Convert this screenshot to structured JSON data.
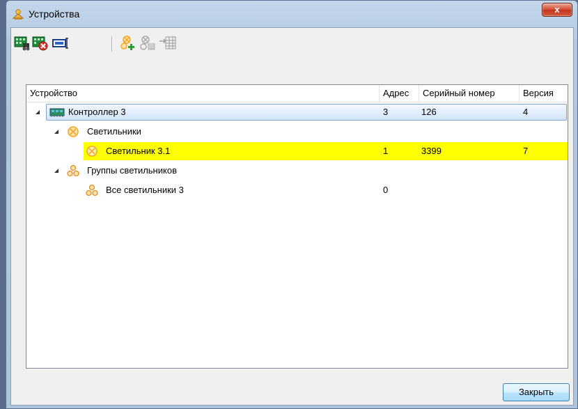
{
  "window": {
    "title": "Устройства",
    "close_symbol": "x"
  },
  "toolbar": {
    "buttons": [
      {
        "icon": "controller-search-icon"
      },
      {
        "icon": "controller-remove-icon"
      },
      {
        "icon": "controller-properties-icon"
      },
      {
        "icon": "add-fixture-icon"
      },
      {
        "icon": "add-fixture-group-icon-disabled"
      },
      {
        "icon": "import-grid-icon-disabled"
      }
    ]
  },
  "tree": {
    "columns": [
      "Устройство",
      "Адрес",
      "Серийный номер",
      "Версия"
    ],
    "rows": [
      {
        "name": "Контроллер 3",
        "address": "3",
        "serial": "126",
        "version": "4",
        "icon": "controller-board-icon",
        "state": "selected"
      },
      {
        "name": "Светильники",
        "address": "",
        "serial": "",
        "version": "",
        "icon": "fixture-icon",
        "state": "normal"
      },
      {
        "name": "Светильник 3.1",
        "address": "1",
        "serial": "3399",
        "version": "7",
        "icon": "fixture-icon",
        "state": "highlighted"
      },
      {
        "name": "Группы светильников",
        "address": "",
        "serial": "",
        "version": "",
        "icon": "fixture-group-icon",
        "state": "normal"
      },
      {
        "name": "Все светильники 3",
        "address": "0",
        "serial": "",
        "version": "",
        "icon": "fixture-group-icon",
        "state": "normal"
      }
    ]
  },
  "footer": {
    "close_label": "Закрыть"
  },
  "colors": {
    "highlight": "#ffff00",
    "selection": "#d3e5fa",
    "fixture_orange": "#f5a623"
  }
}
